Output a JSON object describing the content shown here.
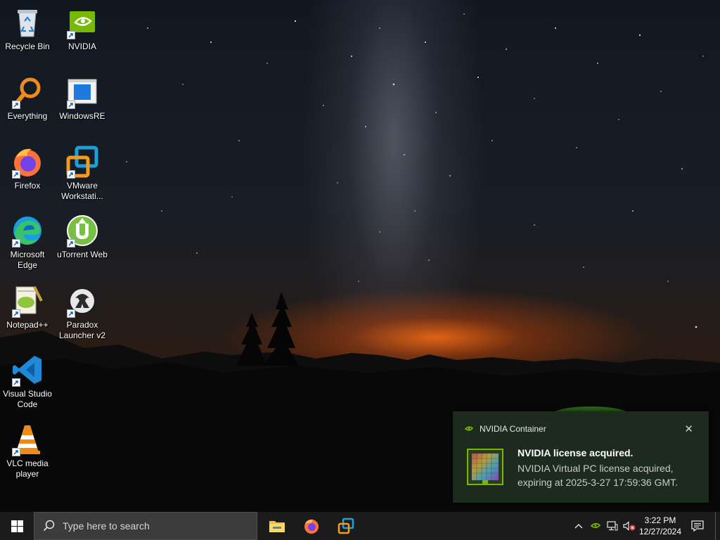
{
  "desktop": {
    "icons": [
      {
        "label": "Recycle Bin",
        "icon": "recycle-bin-icon"
      },
      {
        "label": "NVIDIA",
        "icon": "nvidia-icon"
      },
      {
        "label": "Everything",
        "icon": "everything-search-icon"
      },
      {
        "label": "WindowsRE",
        "icon": "windows-re-icon"
      },
      {
        "label": "Firefox",
        "icon": "firefox-icon"
      },
      {
        "label": "VMware\nWorkstati...",
        "icon": "vmware-icon"
      },
      {
        "label": "Microsoft\nEdge",
        "icon": "edge-icon"
      },
      {
        "label": "uTorrent Web",
        "icon": "utorrent-icon"
      },
      {
        "label": "Notepad++",
        "icon": "notepadpp-icon"
      },
      {
        "label": "Paradox\nLauncher v2",
        "icon": "paradox-icon"
      },
      {
        "label": "Visual Studio\nCode",
        "icon": "vscode-icon"
      },
      {
        "label": "VLC media\nplayer",
        "icon": "vlc-icon"
      }
    ]
  },
  "toast": {
    "app_name": "NVIDIA Container",
    "close_glyph": "✕",
    "title": "NVIDIA license acquired.",
    "body": "NVIDIA Virtual PC license acquired, expiring at 2025-3-27 17:59:36 GMT."
  },
  "taskbar": {
    "search_placeholder": "Type here to search",
    "pinned": [
      {
        "name": "File Explorer",
        "icon": "file-explorer-icon"
      },
      {
        "name": "Firefox",
        "icon": "firefox-icon"
      },
      {
        "name": "VMware Workstation",
        "icon": "vmware-icon"
      }
    ],
    "tray_chevron": "^",
    "clock_time": "3:22 PM",
    "clock_date": "12/27/2024"
  },
  "colors": {
    "taskbar": "#1b1b1b",
    "search_box": "#3b3b3b",
    "toast_bg": "#1d2b1e",
    "nvidia_green": "#76b900"
  }
}
